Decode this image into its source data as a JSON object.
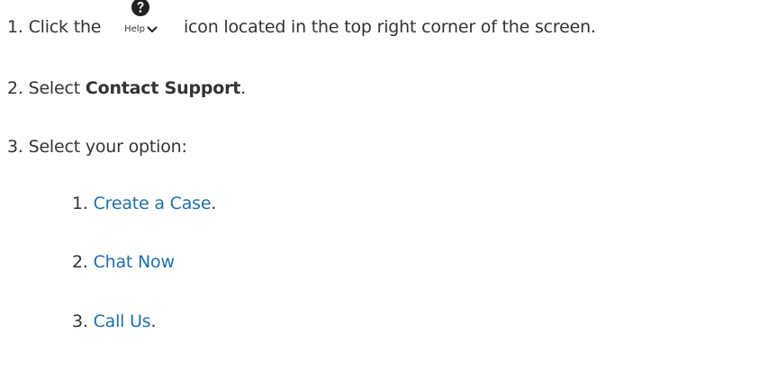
{
  "steps": [
    {
      "number": "1.",
      "before": "Click the",
      "widget": {
        "icon": "question-circle-icon",
        "label": "Help",
        "chevron": "chevron-down-icon"
      },
      "after": "icon located in the top right corner of the screen."
    },
    {
      "number": "2.",
      "text": "Select",
      "bold": "Contact Support",
      "suffix": "."
    },
    {
      "number": "3.",
      "text": "Select your option:"
    }
  ],
  "options": [
    {
      "number": "1.",
      "label": "Create a Case",
      "suffix": "."
    },
    {
      "number": "2.",
      "label": "Chat Now",
      "suffix": ""
    },
    {
      "number": "3.",
      "label": "Call Us",
      "suffix": "."
    }
  ],
  "colors": {
    "text": "#333333",
    "link": "#1f6fa8",
    "icon": "#222222"
  }
}
